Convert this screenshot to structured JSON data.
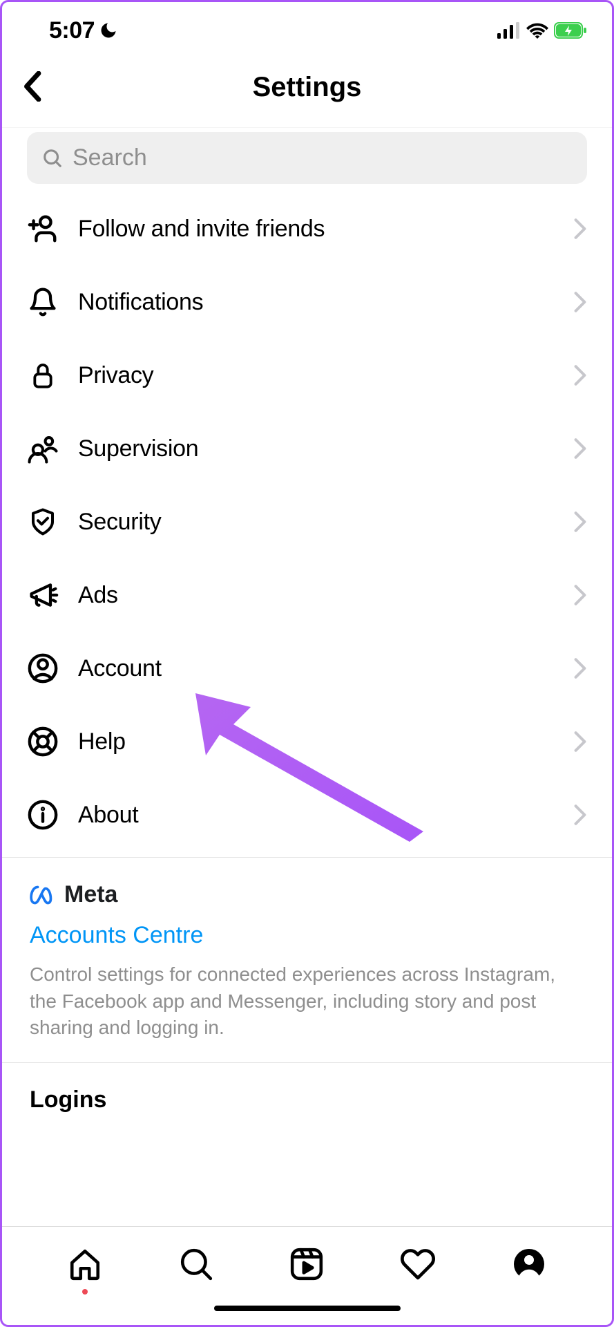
{
  "status": {
    "time": "5:07"
  },
  "header": {
    "title": "Settings"
  },
  "search": {
    "placeholder": "Search"
  },
  "menu": {
    "items": [
      {
        "id": "follow-invite",
        "label": "Follow and invite friends",
        "icon": "person-plus"
      },
      {
        "id": "notifications",
        "label": "Notifications",
        "icon": "bell"
      },
      {
        "id": "privacy",
        "label": "Privacy",
        "icon": "lock"
      },
      {
        "id": "supervision",
        "label": "Supervision",
        "icon": "people"
      },
      {
        "id": "security",
        "label": "Security",
        "icon": "shield-check"
      },
      {
        "id": "ads",
        "label": "Ads",
        "icon": "megaphone"
      },
      {
        "id": "account",
        "label": "Account",
        "icon": "user-circle"
      },
      {
        "id": "help",
        "label": "Help",
        "icon": "lifebuoy"
      },
      {
        "id": "about",
        "label": "About",
        "icon": "info"
      }
    ]
  },
  "meta": {
    "brand": "Meta",
    "link": "Accounts Centre",
    "description": "Control settings for connected experiences across Instagram, the Facebook app and Messenger, including story and post sharing and logging in."
  },
  "logins": {
    "title": "Logins"
  },
  "annotation": {
    "arrow_target": "account",
    "arrow_color": "#a855f7"
  }
}
